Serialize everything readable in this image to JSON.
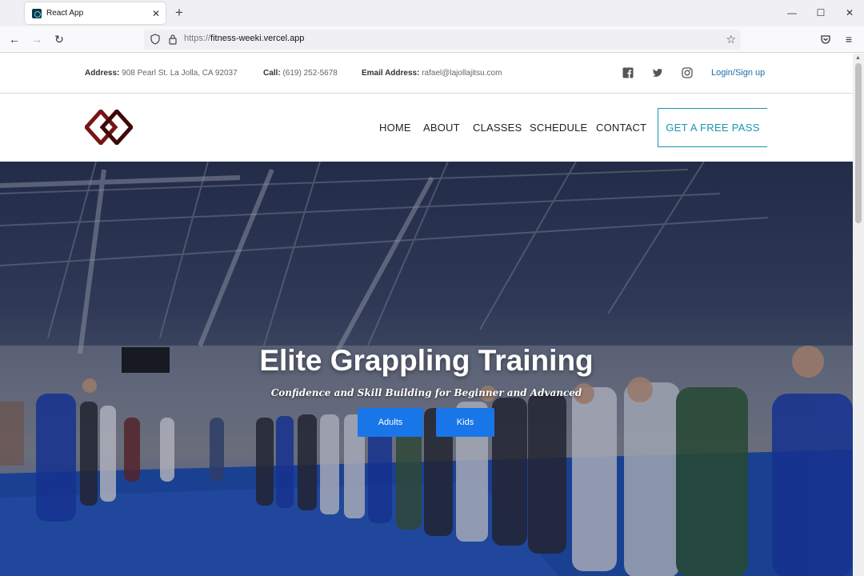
{
  "browser": {
    "tab_title": "React App",
    "url_proto": "https://",
    "url_host": "fitness-weeki.vercel.app"
  },
  "topbar": {
    "address_label": "Address:",
    "address_value": "908 Pearl St. La Jolla, CA 92037",
    "call_label": "Call:",
    "call_value": "(619) 252-5678",
    "email_label": "Email Address:",
    "email_value": "rafael@lajollajitsu.com",
    "social_icons": [
      "facebook-icon",
      "twitter-icon",
      "instagram-icon"
    ],
    "login_label": "Login/Sign up"
  },
  "nav": {
    "items": [
      {
        "label": "HOME"
      },
      {
        "label": "ABOUT"
      },
      {
        "label": "CLASSES"
      },
      {
        "label": "SCHEDULE"
      },
      {
        "label": "CONTACT"
      }
    ],
    "cta_label": "GET A FREE PASS"
  },
  "hero": {
    "title": "Elite Grappling Training",
    "subtitle": "Confidence and Skill Building for Beginner and Advanced",
    "buttons": [
      {
        "label": "Adults"
      },
      {
        "label": "Kids"
      }
    ]
  },
  "colors": {
    "accent": "#1a96b3",
    "button_blue": "#1976e8",
    "logo_red": "#7a1414",
    "link_blue": "#1c6fa8"
  }
}
